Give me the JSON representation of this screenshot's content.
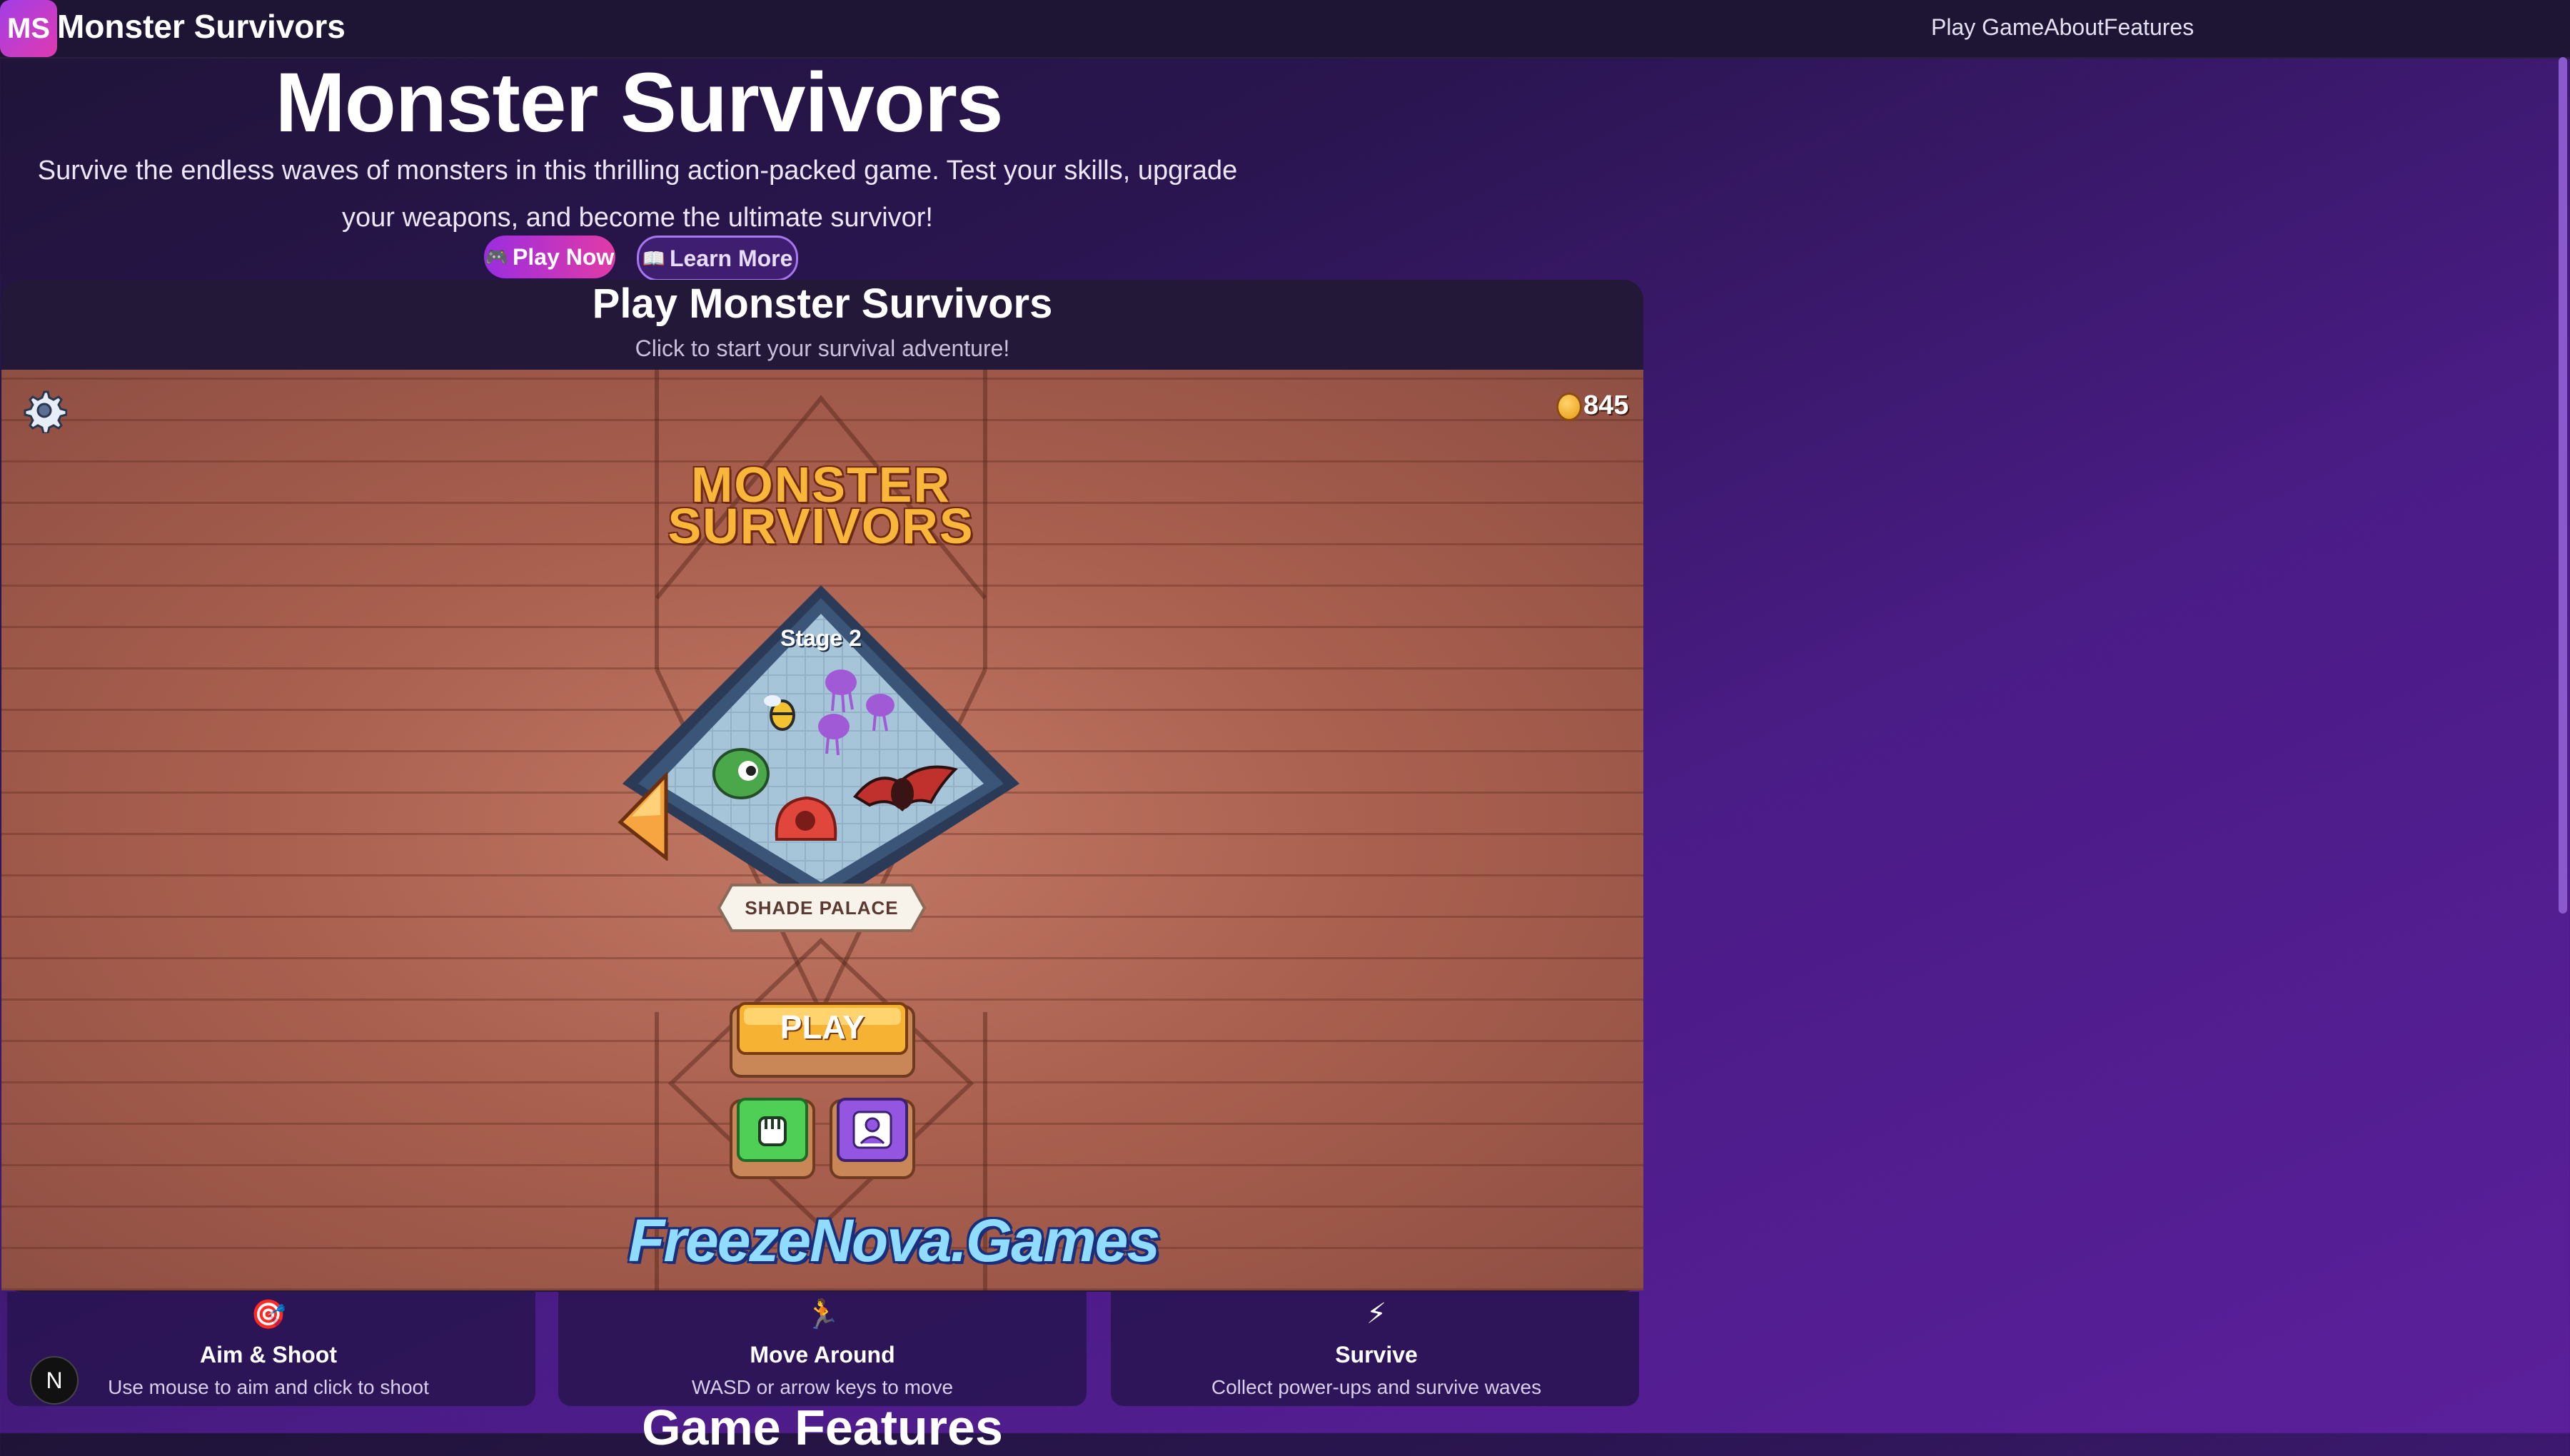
{
  "header": {
    "logo_text": "MS",
    "brand": "Monster Survivors",
    "nav": [
      "Play Game",
      "About",
      "Features"
    ]
  },
  "hero": {
    "title": "Monster Survivors",
    "description": "Survive the endless waves of monsters in this thrilling action-packed game. Test your skills, upgrade your weapons, and become the ultimate survivor!",
    "play_now_emoji": "🎮",
    "play_now_label": "Play Now",
    "learn_more_emoji": "📖",
    "learn_more_label": "Learn More"
  },
  "game_section": {
    "title": "Play Monster Survivors",
    "subtitle": "Click to start your survival adventure!"
  },
  "game": {
    "coins": "845",
    "logo_line1": "MONSTER",
    "logo_line2": "SURVIVORS",
    "stage": "Stage 2",
    "location": "SHADE PALACE",
    "play_label": "PLAY",
    "studio": "FreezeNova.Games"
  },
  "features": [
    {
      "icon": "🎯",
      "title": "Aim & Shoot",
      "desc": "Use mouse to aim and click to shoot"
    },
    {
      "icon": "🏃",
      "title": "Move Around",
      "desc": "WASD or arrow keys to move"
    },
    {
      "icon": "⚡",
      "title": "Survive",
      "desc": "Collect power-ups and survive waves"
    }
  ],
  "next_section_title": "Game Features",
  "devtools_badge": "N",
  "colors": {
    "accent": "#9b2de0",
    "pink": "#e23aa6",
    "coin": "#ffd36a",
    "play_button": "#f6b233"
  }
}
